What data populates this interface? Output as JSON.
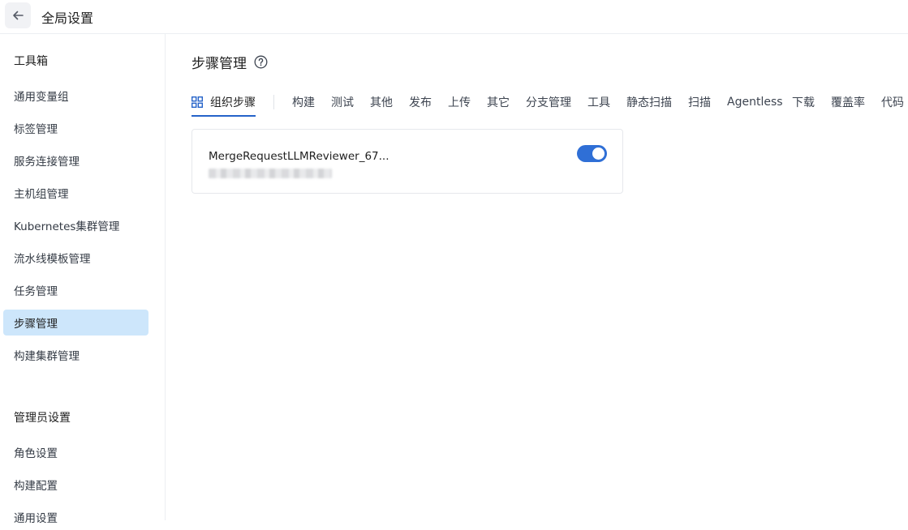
{
  "header": {
    "title": "全局设置"
  },
  "sidebar": {
    "group1_title": "工具箱",
    "items": [
      {
        "label": "通用变量组"
      },
      {
        "label": "标签管理"
      },
      {
        "label": "服务连接管理"
      },
      {
        "label": "主机组管理"
      },
      {
        "label": "Kubernetes集群管理"
      },
      {
        "label": "流水线模板管理"
      },
      {
        "label": "任务管理"
      },
      {
        "label": "步骤管理",
        "active": true
      },
      {
        "label": "构建集群管理"
      }
    ],
    "group2_title": "管理员设置",
    "admin_items": [
      {
        "label": "角色设置"
      },
      {
        "label": "构建配置"
      },
      {
        "label": "通用设置"
      }
    ]
  },
  "main": {
    "title": "步骤管理",
    "tabs": [
      {
        "label": "组织步骤",
        "active": true
      },
      {
        "label": "构建"
      },
      {
        "label": "测试"
      },
      {
        "label": "其他"
      },
      {
        "label": "发布"
      },
      {
        "label": "上传"
      },
      {
        "label": "其它"
      },
      {
        "label": "分支管理"
      },
      {
        "label": "工具"
      },
      {
        "label": "静态扫描"
      },
      {
        "label": "扫描"
      },
      {
        "label": "Agentless"
      },
      {
        "label": "下载"
      },
      {
        "label": "覆盖率"
      },
      {
        "label": "代码"
      }
    ],
    "card": {
      "title": "MergeRequestLLMReviewer_67...",
      "enabled": true
    }
  },
  "colors": {
    "accent": "#2563c9",
    "active_bg": "#cde6fb",
    "toggle_on": "#2f6fd6"
  },
  "icons": {
    "back": "arrow-left-icon",
    "help": "question-circle-icon",
    "org_tab": "grid-icon"
  }
}
